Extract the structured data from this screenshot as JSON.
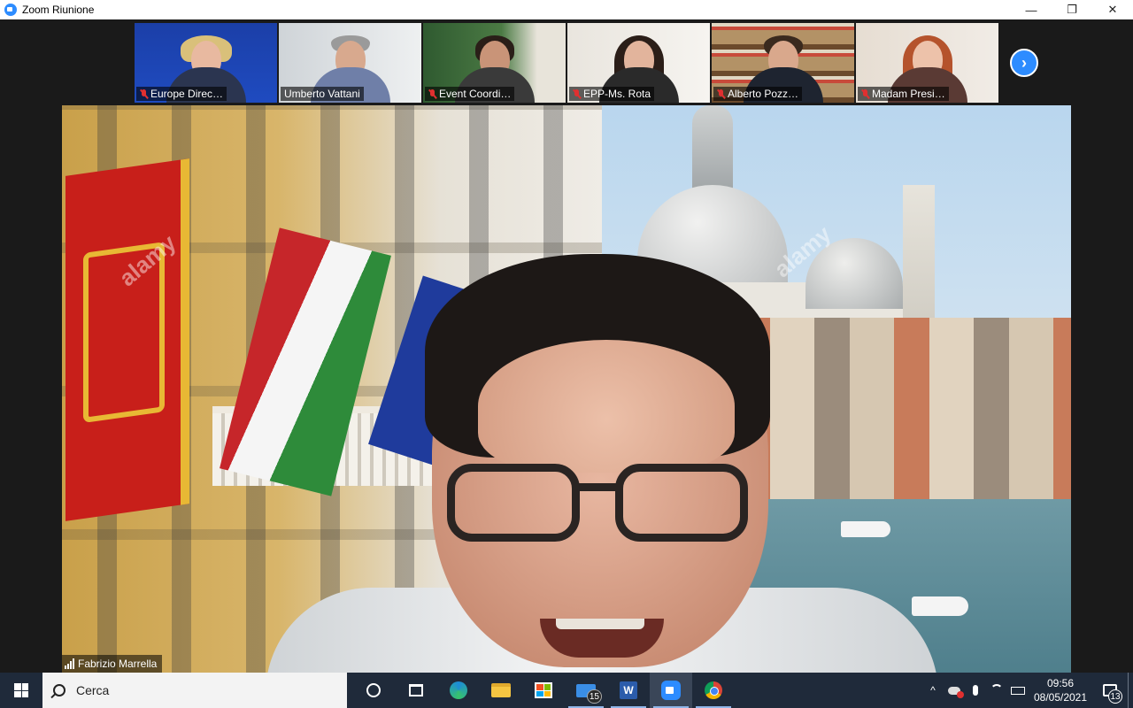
{
  "window": {
    "title": "Zoom Riunione",
    "minimize_glyph": "—",
    "maximize_glyph": "❐",
    "close_glyph": "✕"
  },
  "thumbnails": [
    {
      "name": "Europe Direc…",
      "muted": true,
      "bg": "#1b3fa8"
    },
    {
      "name": "Umberto Vattani",
      "muted": false,
      "bg": "#dfe3e6"
    },
    {
      "name": "Event Coordi…",
      "muted": true,
      "bg": "#3f6a3a"
    },
    {
      "name": "EPP-Ms. Rota",
      "muted": true,
      "bg": "#eeeae4"
    },
    {
      "name": "Alberto Pozz…",
      "muted": true,
      "bg": "#8a6a44"
    },
    {
      "name": "Madam Presi…",
      "muted": true,
      "bg": "#e9e1d8"
    }
  ],
  "next_button_glyph": "›",
  "speaker": {
    "name": "Fabrizio Marrella",
    "watermark": "alamy"
  },
  "taskbar": {
    "search_placeholder": "Cerca",
    "mail_badge": "15",
    "word_letter": "W",
    "time": "09:56",
    "date": "08/05/2021",
    "notifications_count": "13",
    "tray_up_glyph": "^"
  },
  "colors": {
    "zoom_blue": "#2d8cff",
    "muted_red": "#e03030",
    "taskbar": "#1f2a3a"
  }
}
